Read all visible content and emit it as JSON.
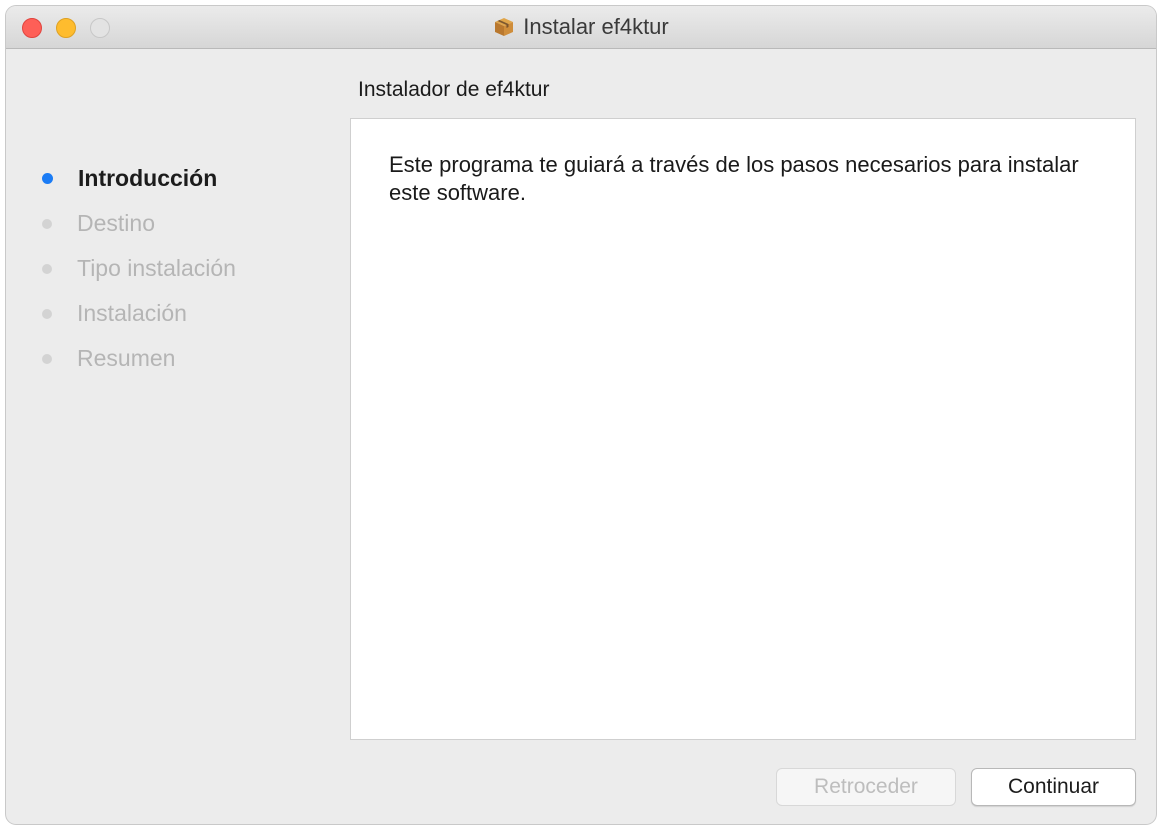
{
  "window": {
    "title": "Instalar ef4ktur",
    "title_icon": "package-icon"
  },
  "heading": "Instalador de ef4ktur",
  "steps": [
    {
      "label": "Introducción",
      "active": true
    },
    {
      "label": "Destino",
      "active": false
    },
    {
      "label": "Tipo instalación",
      "active": false
    },
    {
      "label": "Instalación",
      "active": false
    },
    {
      "label": "Resumen",
      "active": false
    }
  ],
  "content": {
    "text": "Este programa te guiará a través de los pasos necesarios para instalar este software."
  },
  "buttons": {
    "back_label": "Retroceder",
    "continue_label": "Continuar"
  },
  "colors": {
    "active_step_dot": "#1b7cf5",
    "inactive_step_dot": "#d3d3d3",
    "close": "#fe5f57",
    "minimize": "#febc2e",
    "zoom": "#e3e3e3"
  }
}
